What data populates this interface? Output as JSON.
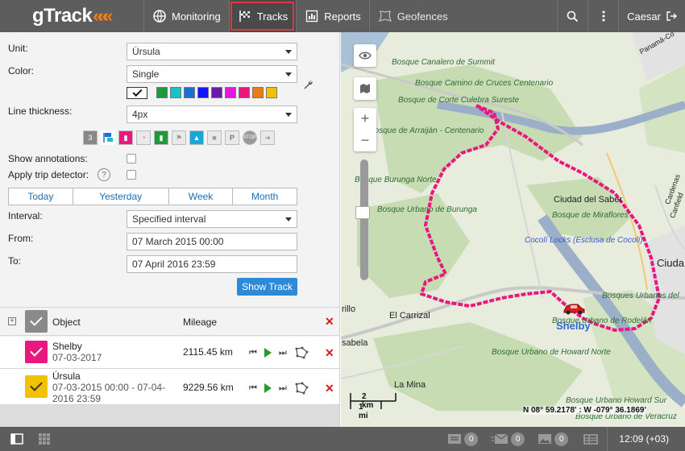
{
  "brand": {
    "logo_text": "gTrack",
    "logo_accent": "#f07c1a"
  },
  "nav": [
    {
      "label": "Monitoring",
      "icon": "globe-icon",
      "active": false
    },
    {
      "label": "Tracks",
      "icon": "checkered-flag-icon",
      "active": true
    },
    {
      "label": "Reports",
      "icon": "report-chart-icon",
      "active": false
    },
    {
      "label": "Geofences",
      "icon": "geofence-icon",
      "active": false
    }
  ],
  "topbar": {
    "user": "Caesar",
    "search_icon": "search-icon",
    "menu_icon": "more-vertical-icon",
    "logout_icon": "logout-icon"
  },
  "form": {
    "unit_label": "Unit:",
    "unit_value": "Úrsula",
    "color_label": "Color:",
    "color_value": "Single",
    "palette": [
      "#1f9a3a",
      "#19c1c8",
      "#1a6ed6",
      "#1414ff",
      "#6a1ba8",
      "#e319e3",
      "#e8187e",
      "#f07a10",
      "#f2c200"
    ],
    "line_thickness_label": "Line thickness:",
    "line_thickness_value": "4px",
    "show_annotations_label": "Show annotations:",
    "apply_trip_detector_label": "Apply trip detector:",
    "help_text": "?",
    "interval_tabs": [
      "Today",
      "Yesterday",
      "Week",
      "Month"
    ],
    "interval_label": "Interval:",
    "interval_value": "Specified interval",
    "from_label": "From:",
    "from_value": "07 March 2015 00:00",
    "to_label": "To:",
    "to_value": "07 April 2016 23:59",
    "show_button": "Show Track"
  },
  "table": {
    "col_object": "Object",
    "col_mileage": "Mileage",
    "rows": [
      {
        "name": "Shelby",
        "date": "07-03-2017",
        "mileage": "2115.45 km",
        "color": "#e8187e"
      },
      {
        "name": "Úrsula",
        "date": "07-03-2015 00:00 - 07-04-2016 23:59",
        "mileage": "9229.56 km",
        "color": "#f2c200"
      }
    ]
  },
  "map": {
    "labels": {
      "canalero": "Bosque Canalero de Summit",
      "cruces": "Bosque Camino de Cruces Centenario",
      "culebra": "Bosque de Corte Culebra Sureste",
      "arraijan": "Bosque de Arraiján - Centenario",
      "burunga_n": "Bosque Burunga Norte",
      "burunga_u": "Bosque Urbano de Burunga",
      "ciudad_saber": "Ciudad del Saber",
      "miraflores": "Bosque de Miraflores",
      "cocoli": "Cocolí Locks (Esclusa de Cocolí)",
      "carrizal": "El Carrizal",
      "rodelan": "Bosque Urbano de Rodelán",
      "howard_n": "Bosque Urbano de Howard Norte",
      "howard_s": "Bosque Urbano Howard Sur",
      "veracruz": "Bosque Urbano de Veracruz",
      "la_mina": "La Mina",
      "panama": "Panamá-Co",
      "ciuda": "Ciuda",
      "urbanos_del": "Bosques Urbanos del",
      "rillo": "rillo",
      "isabela": "sabela",
      "cardenas": "Cardenas",
      "canfield": "Canfield"
    },
    "unit_name": "Shelby",
    "scale_km": "2 km",
    "scale_mi": "1 mi",
    "coords": "N 08° 59.2178' : W -079° 36.1869'",
    "track_color": "#e8187e"
  },
  "bottombar": {
    "counts": [
      {
        "icon": "message-icon",
        "value": "0"
      },
      {
        "icon": "mail-icon",
        "value": "0"
      },
      {
        "icon": "image-icon",
        "value": "0"
      }
    ],
    "time": "12:09 (+03)"
  }
}
